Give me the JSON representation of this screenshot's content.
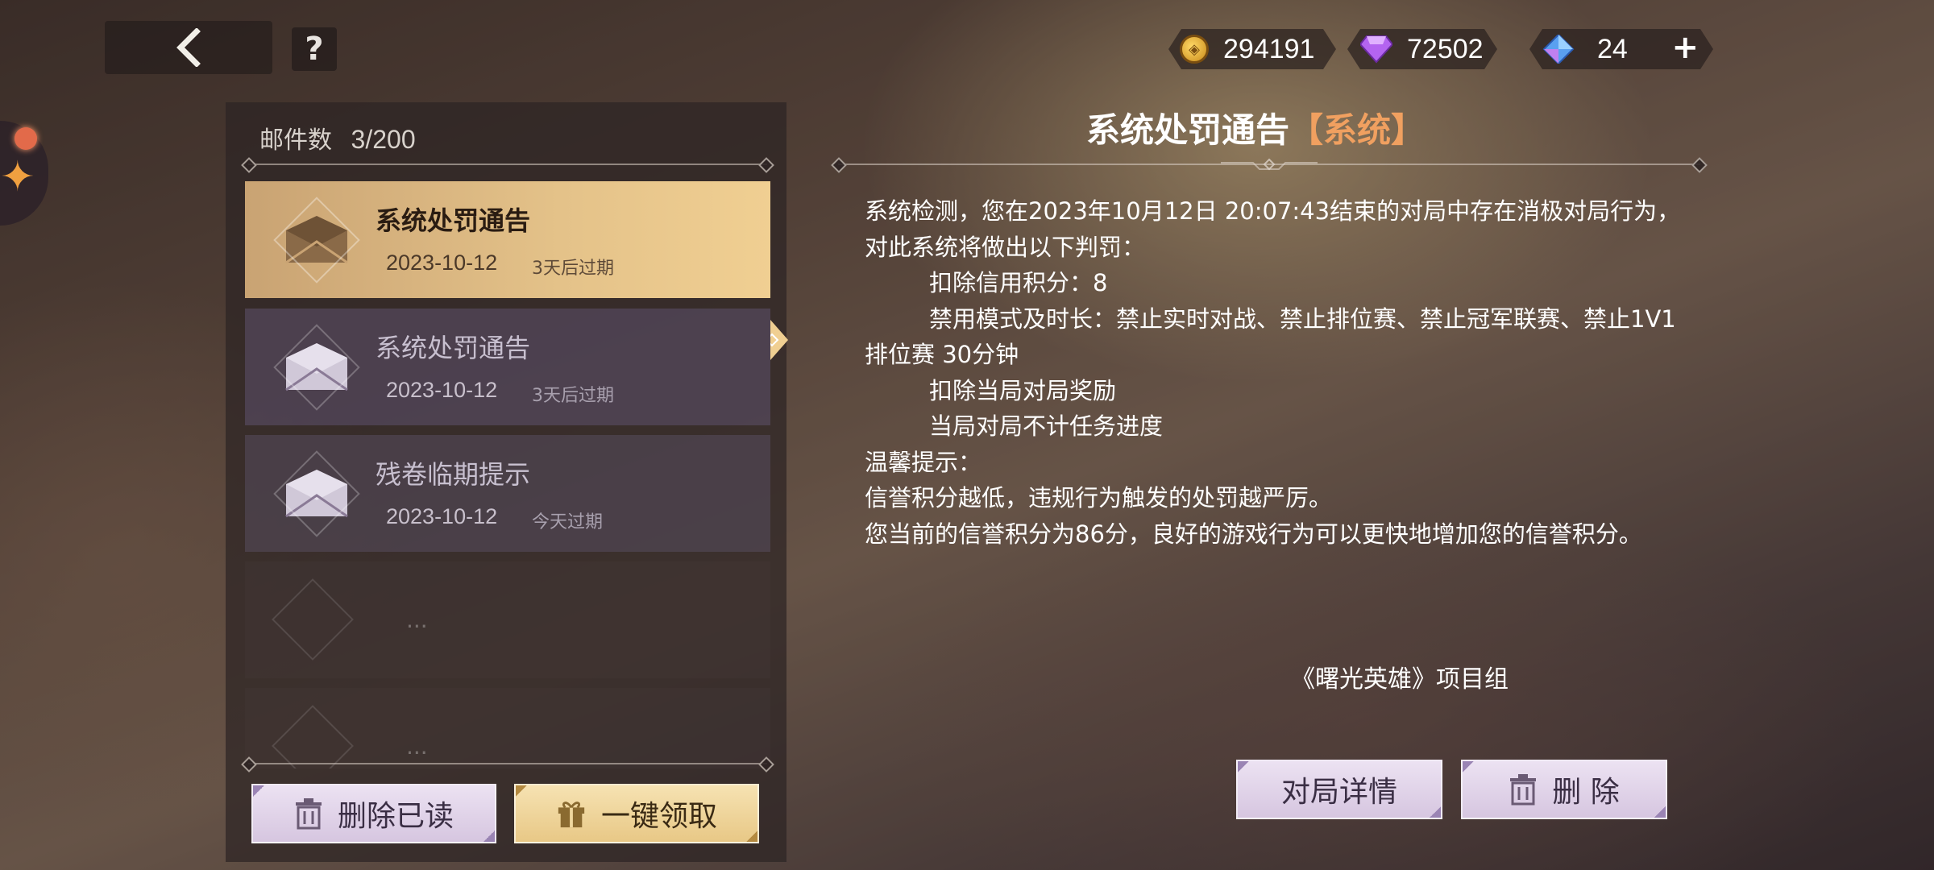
{
  "header": {
    "currencies": [
      {
        "name": "gold-coin",
        "value": "294191",
        "color": "#f0b830"
      },
      {
        "name": "purple-gem",
        "value": "72502",
        "color": "#b060f0"
      },
      {
        "name": "blue-crystal",
        "value": "24",
        "color": "#60a0f0"
      }
    ],
    "help_label": "?",
    "plus_label": "+"
  },
  "mail_panel": {
    "count_label": "邮件数",
    "count_value": "3/200",
    "items": [
      {
        "title": "系统处罚通告",
        "date": "2023-10-12",
        "expire": "3天后过期",
        "state": "selected"
      },
      {
        "title": "系统处罚通告",
        "date": "2023-10-12",
        "expire": "3天后过期",
        "state": "read"
      },
      {
        "title": "残卷临期提示",
        "date": "2023-10-12",
        "expire": "今天过期",
        "state": "read"
      }
    ],
    "empty_dots": "...",
    "delete_read_label": "删除已读",
    "claim_all_label": "一键领取"
  },
  "detail": {
    "title": "系统处罚通告",
    "tag": "【系统】",
    "lines": [
      "系统检测，您在2023年10月12日 20:07:43结束的对局中存在消极对局行为，对此系统将做出以下判罚：",
      "扣除信用积分：8",
      "禁用模式及时长：禁止实时对战、禁止排位赛、禁止冠军联赛、禁止1V1排位赛 30分钟",
      "扣除当局对局奖励",
      "当局对局不计任务进度",
      "温馨提示：",
      "信誉积分越低，违规行为触发的处罚越严厉。",
      "您当前的信誉积分为86分，良好的游戏行为可以更快地增加您的信誉积分。"
    ],
    "signature": "《曙光英雄》项目组",
    "match_detail_label": "对局详情",
    "delete_label": "删 除"
  }
}
